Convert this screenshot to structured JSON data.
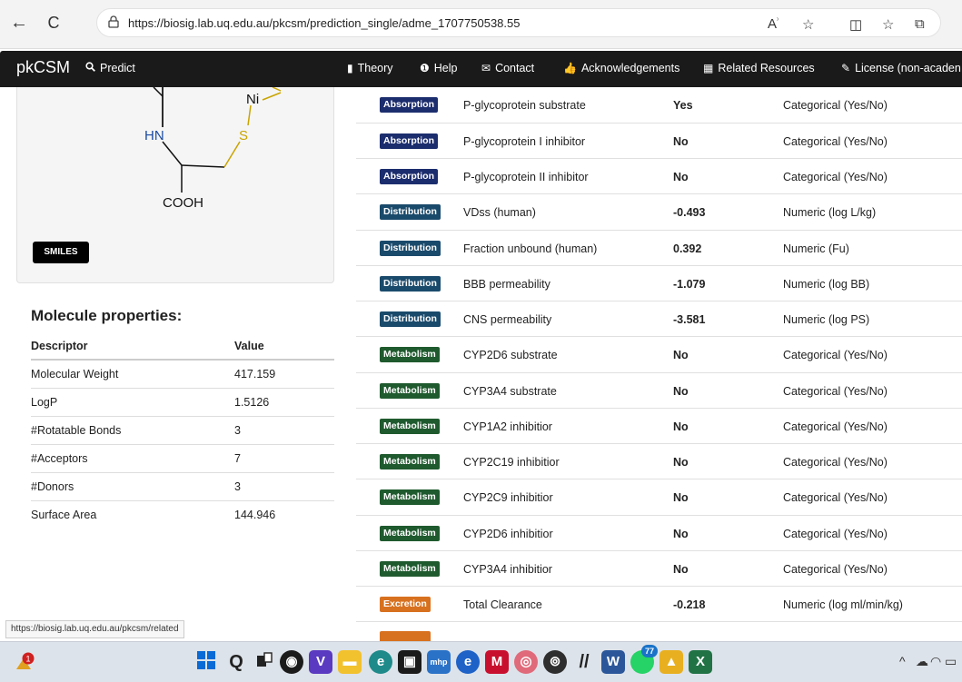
{
  "browser": {
    "url": "https://biosig.lab.uq.edu.au/pkcsm/prediction_single/adme_1707750538.55",
    "back_icon": "←",
    "refresh_icon": "C",
    "lock_icon": "🔒",
    "read_aloud": "Á",
    "fav": "☆",
    "split": "◫",
    "favorites": "☆",
    "collections": "⧉"
  },
  "navbar": {
    "brand": "pkCSM",
    "predict": "Predict",
    "theory": "Theory",
    "help": "Help",
    "contact": "Contact",
    "acknowledgements": "Acknowledgements",
    "related": "Related Resources",
    "license": "License (non-acaden"
  },
  "molecule": {
    "atoms": {
      "ni": "Ni",
      "hn": "HN",
      "s": "S",
      "cooh": "COOH"
    },
    "smiles_button": "SMILES"
  },
  "properties": {
    "title": "Molecule properties:",
    "headers": [
      "Descriptor",
      "Value"
    ],
    "rows": [
      [
        "Molecular Weight",
        "417.159"
      ],
      [
        "LogP",
        "1.5126"
      ],
      [
        "#Rotatable Bonds",
        "3"
      ],
      [
        "#Acceptors",
        "7"
      ],
      [
        "#Donors",
        "3"
      ],
      [
        "Surface Area",
        "144.946"
      ]
    ]
  },
  "results": [
    {
      "category": "Absorption",
      "cls": "b-abs",
      "property": "P-glycoprotein substrate",
      "value": "Yes",
      "unit": "Categorical (Yes/No)"
    },
    {
      "category": "Absorption",
      "cls": "b-abs",
      "property": "P-glycoprotein I inhibitor",
      "value": "No",
      "unit": "Categorical (Yes/No)"
    },
    {
      "category": "Absorption",
      "cls": "b-abs",
      "property": "P-glycoprotein II inhibitor",
      "value": "No",
      "unit": "Categorical (Yes/No)"
    },
    {
      "category": "Distribution",
      "cls": "b-dist",
      "property": "VDss (human)",
      "value": "-0.493",
      "unit": "Numeric (log L/kg)"
    },
    {
      "category": "Distribution",
      "cls": "b-dist",
      "property": "Fraction unbound (human)",
      "value": "0.392",
      "unit": "Numeric (Fu)"
    },
    {
      "category": "Distribution",
      "cls": "b-dist",
      "property": "BBB permeability",
      "value": "-1.079",
      "unit": "Numeric (log BB)"
    },
    {
      "category": "Distribution",
      "cls": "b-dist",
      "property": "CNS permeability",
      "value": "-3.581",
      "unit": "Numeric (log PS)"
    },
    {
      "category": "Metabolism",
      "cls": "b-met",
      "property": "CYP2D6 substrate",
      "value": "No",
      "unit": "Categorical (Yes/No)"
    },
    {
      "category": "Metabolism",
      "cls": "b-met",
      "property": "CYP3A4 substrate",
      "value": "No",
      "unit": "Categorical (Yes/No)"
    },
    {
      "category": "Metabolism",
      "cls": "b-met",
      "property": "CYP1A2 inhibitior",
      "value": "No",
      "unit": "Categorical (Yes/No)"
    },
    {
      "category": "Metabolism",
      "cls": "b-met",
      "property": "CYP2C19 inhibitior",
      "value": "No",
      "unit": "Categorical (Yes/No)"
    },
    {
      "category": "Metabolism",
      "cls": "b-met",
      "property": "CYP2C9 inhibitior",
      "value": "No",
      "unit": "Categorical (Yes/No)"
    },
    {
      "category": "Metabolism",
      "cls": "b-met",
      "property": "CYP2D6 inhibitior",
      "value": "No",
      "unit": "Categorical (Yes/No)"
    },
    {
      "category": "Metabolism",
      "cls": "b-met",
      "property": "CYP3A4 inhibitior",
      "value": "No",
      "unit": "Categorical (Yes/No)"
    },
    {
      "category": "Excretion",
      "cls": "b-exc",
      "property": "Total Clearance",
      "value": "-0.218",
      "unit": "Numeric (log ml/min/kg)"
    }
  ],
  "status_url": "https://biosig.lab.uq.edu.au/pkcsm/related",
  "taskbar": {
    "notification_badge": "1",
    "whatsapp_badge": "77",
    "tray_up": "^"
  }
}
